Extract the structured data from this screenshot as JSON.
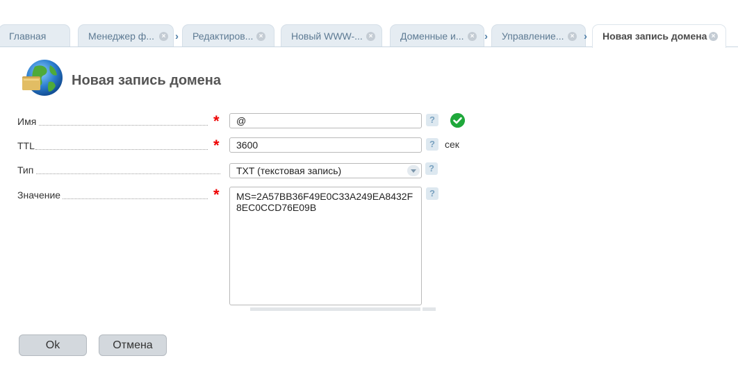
{
  "tabs": [
    {
      "label": "Главная",
      "closable": false
    },
    {
      "label": "Менеджер ф...",
      "closable": true
    },
    {
      "label": "Редактиров...",
      "closable": true
    },
    {
      "label": "Новый WWW-...",
      "closable": true
    },
    {
      "label": "Доменные и...",
      "closable": true
    },
    {
      "label": "Управление...",
      "closable": true
    },
    {
      "label": "Новая запись домена",
      "closable": true,
      "active": true
    }
  ],
  "page": {
    "title": "Новая запись домена",
    "icon": "globe-folder-icon"
  },
  "form": {
    "name": {
      "label": "Имя",
      "value": "@",
      "required": true,
      "valid": true
    },
    "ttl": {
      "label": "TTL",
      "value": "3600",
      "required": true,
      "unit": "сек"
    },
    "type": {
      "label": "Тип",
      "value": "TXT (текстовая запись)"
    },
    "value": {
      "label": "Значение",
      "value": "MS=2A57BB36F49E0C33A249EA8432F8EC0CCD76E09B",
      "required": true
    },
    "help_glyph": "?",
    "required_glyph": "*"
  },
  "buttons": {
    "ok": "Ok",
    "cancel": "Отмена"
  },
  "colors": {
    "tab_bg": "#e5ecf2",
    "tab_text": "#5d7a93",
    "required": "#e00000",
    "valid": "#1fa83b",
    "button_bg": "#d3d8dd"
  }
}
